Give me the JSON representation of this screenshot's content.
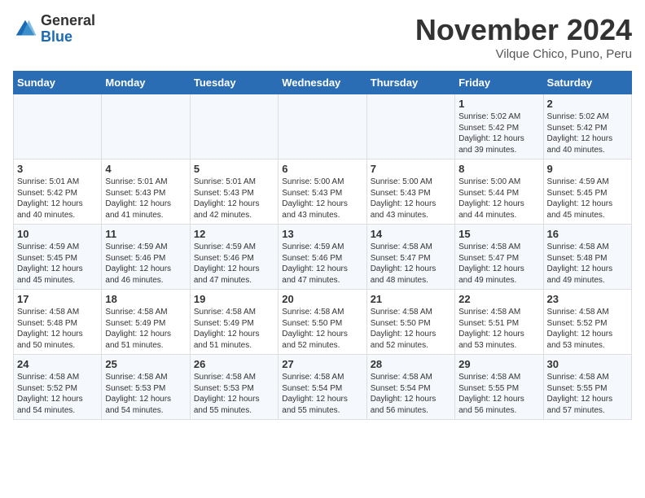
{
  "header": {
    "logo_general": "General",
    "logo_blue": "Blue",
    "month_title": "November 2024",
    "subtitle": "Vilque Chico, Puno, Peru"
  },
  "days_of_week": [
    "Sunday",
    "Monday",
    "Tuesday",
    "Wednesday",
    "Thursday",
    "Friday",
    "Saturday"
  ],
  "weeks": [
    [
      {
        "day": "",
        "info": ""
      },
      {
        "day": "",
        "info": ""
      },
      {
        "day": "",
        "info": ""
      },
      {
        "day": "",
        "info": ""
      },
      {
        "day": "",
        "info": ""
      },
      {
        "day": "1",
        "info": "Sunrise: 5:02 AM\nSunset: 5:42 PM\nDaylight: 12 hours\nand 39 minutes."
      },
      {
        "day": "2",
        "info": "Sunrise: 5:02 AM\nSunset: 5:42 PM\nDaylight: 12 hours\nand 40 minutes."
      }
    ],
    [
      {
        "day": "3",
        "info": "Sunrise: 5:01 AM\nSunset: 5:42 PM\nDaylight: 12 hours\nand 40 minutes."
      },
      {
        "day": "4",
        "info": "Sunrise: 5:01 AM\nSunset: 5:43 PM\nDaylight: 12 hours\nand 41 minutes."
      },
      {
        "day": "5",
        "info": "Sunrise: 5:01 AM\nSunset: 5:43 PM\nDaylight: 12 hours\nand 42 minutes."
      },
      {
        "day": "6",
        "info": "Sunrise: 5:00 AM\nSunset: 5:43 PM\nDaylight: 12 hours\nand 43 minutes."
      },
      {
        "day": "7",
        "info": "Sunrise: 5:00 AM\nSunset: 5:43 PM\nDaylight: 12 hours\nand 43 minutes."
      },
      {
        "day": "8",
        "info": "Sunrise: 5:00 AM\nSunset: 5:44 PM\nDaylight: 12 hours\nand 44 minutes."
      },
      {
        "day": "9",
        "info": "Sunrise: 4:59 AM\nSunset: 5:45 PM\nDaylight: 12 hours\nand 45 minutes."
      }
    ],
    [
      {
        "day": "10",
        "info": "Sunrise: 4:59 AM\nSunset: 5:45 PM\nDaylight: 12 hours\nand 45 minutes."
      },
      {
        "day": "11",
        "info": "Sunrise: 4:59 AM\nSunset: 5:46 PM\nDaylight: 12 hours\nand 46 minutes."
      },
      {
        "day": "12",
        "info": "Sunrise: 4:59 AM\nSunset: 5:46 PM\nDaylight: 12 hours\nand 47 minutes."
      },
      {
        "day": "13",
        "info": "Sunrise: 4:59 AM\nSunset: 5:46 PM\nDaylight: 12 hours\nand 47 minutes."
      },
      {
        "day": "14",
        "info": "Sunrise: 4:58 AM\nSunset: 5:47 PM\nDaylight: 12 hours\nand 48 minutes."
      },
      {
        "day": "15",
        "info": "Sunrise: 4:58 AM\nSunset: 5:47 PM\nDaylight: 12 hours\nand 49 minutes."
      },
      {
        "day": "16",
        "info": "Sunrise: 4:58 AM\nSunset: 5:48 PM\nDaylight: 12 hours\nand 49 minutes."
      }
    ],
    [
      {
        "day": "17",
        "info": "Sunrise: 4:58 AM\nSunset: 5:48 PM\nDaylight: 12 hours\nand 50 minutes."
      },
      {
        "day": "18",
        "info": "Sunrise: 4:58 AM\nSunset: 5:49 PM\nDaylight: 12 hours\nand 51 minutes."
      },
      {
        "day": "19",
        "info": "Sunrise: 4:58 AM\nSunset: 5:49 PM\nDaylight: 12 hours\nand 51 minutes."
      },
      {
        "day": "20",
        "info": "Sunrise: 4:58 AM\nSunset: 5:50 PM\nDaylight: 12 hours\nand 52 minutes."
      },
      {
        "day": "21",
        "info": "Sunrise: 4:58 AM\nSunset: 5:50 PM\nDaylight: 12 hours\nand 52 minutes."
      },
      {
        "day": "22",
        "info": "Sunrise: 4:58 AM\nSunset: 5:51 PM\nDaylight: 12 hours\nand 53 minutes."
      },
      {
        "day": "23",
        "info": "Sunrise: 4:58 AM\nSunset: 5:52 PM\nDaylight: 12 hours\nand 53 minutes."
      }
    ],
    [
      {
        "day": "24",
        "info": "Sunrise: 4:58 AM\nSunset: 5:52 PM\nDaylight: 12 hours\nand 54 minutes."
      },
      {
        "day": "25",
        "info": "Sunrise: 4:58 AM\nSunset: 5:53 PM\nDaylight: 12 hours\nand 54 minutes."
      },
      {
        "day": "26",
        "info": "Sunrise: 4:58 AM\nSunset: 5:53 PM\nDaylight: 12 hours\nand 55 minutes."
      },
      {
        "day": "27",
        "info": "Sunrise: 4:58 AM\nSunset: 5:54 PM\nDaylight: 12 hours\nand 55 minutes."
      },
      {
        "day": "28",
        "info": "Sunrise: 4:58 AM\nSunset: 5:54 PM\nDaylight: 12 hours\nand 56 minutes."
      },
      {
        "day": "29",
        "info": "Sunrise: 4:58 AM\nSunset: 5:55 PM\nDaylight: 12 hours\nand 56 minutes."
      },
      {
        "day": "30",
        "info": "Sunrise: 4:58 AM\nSunset: 5:55 PM\nDaylight: 12 hours\nand 57 minutes."
      }
    ]
  ]
}
